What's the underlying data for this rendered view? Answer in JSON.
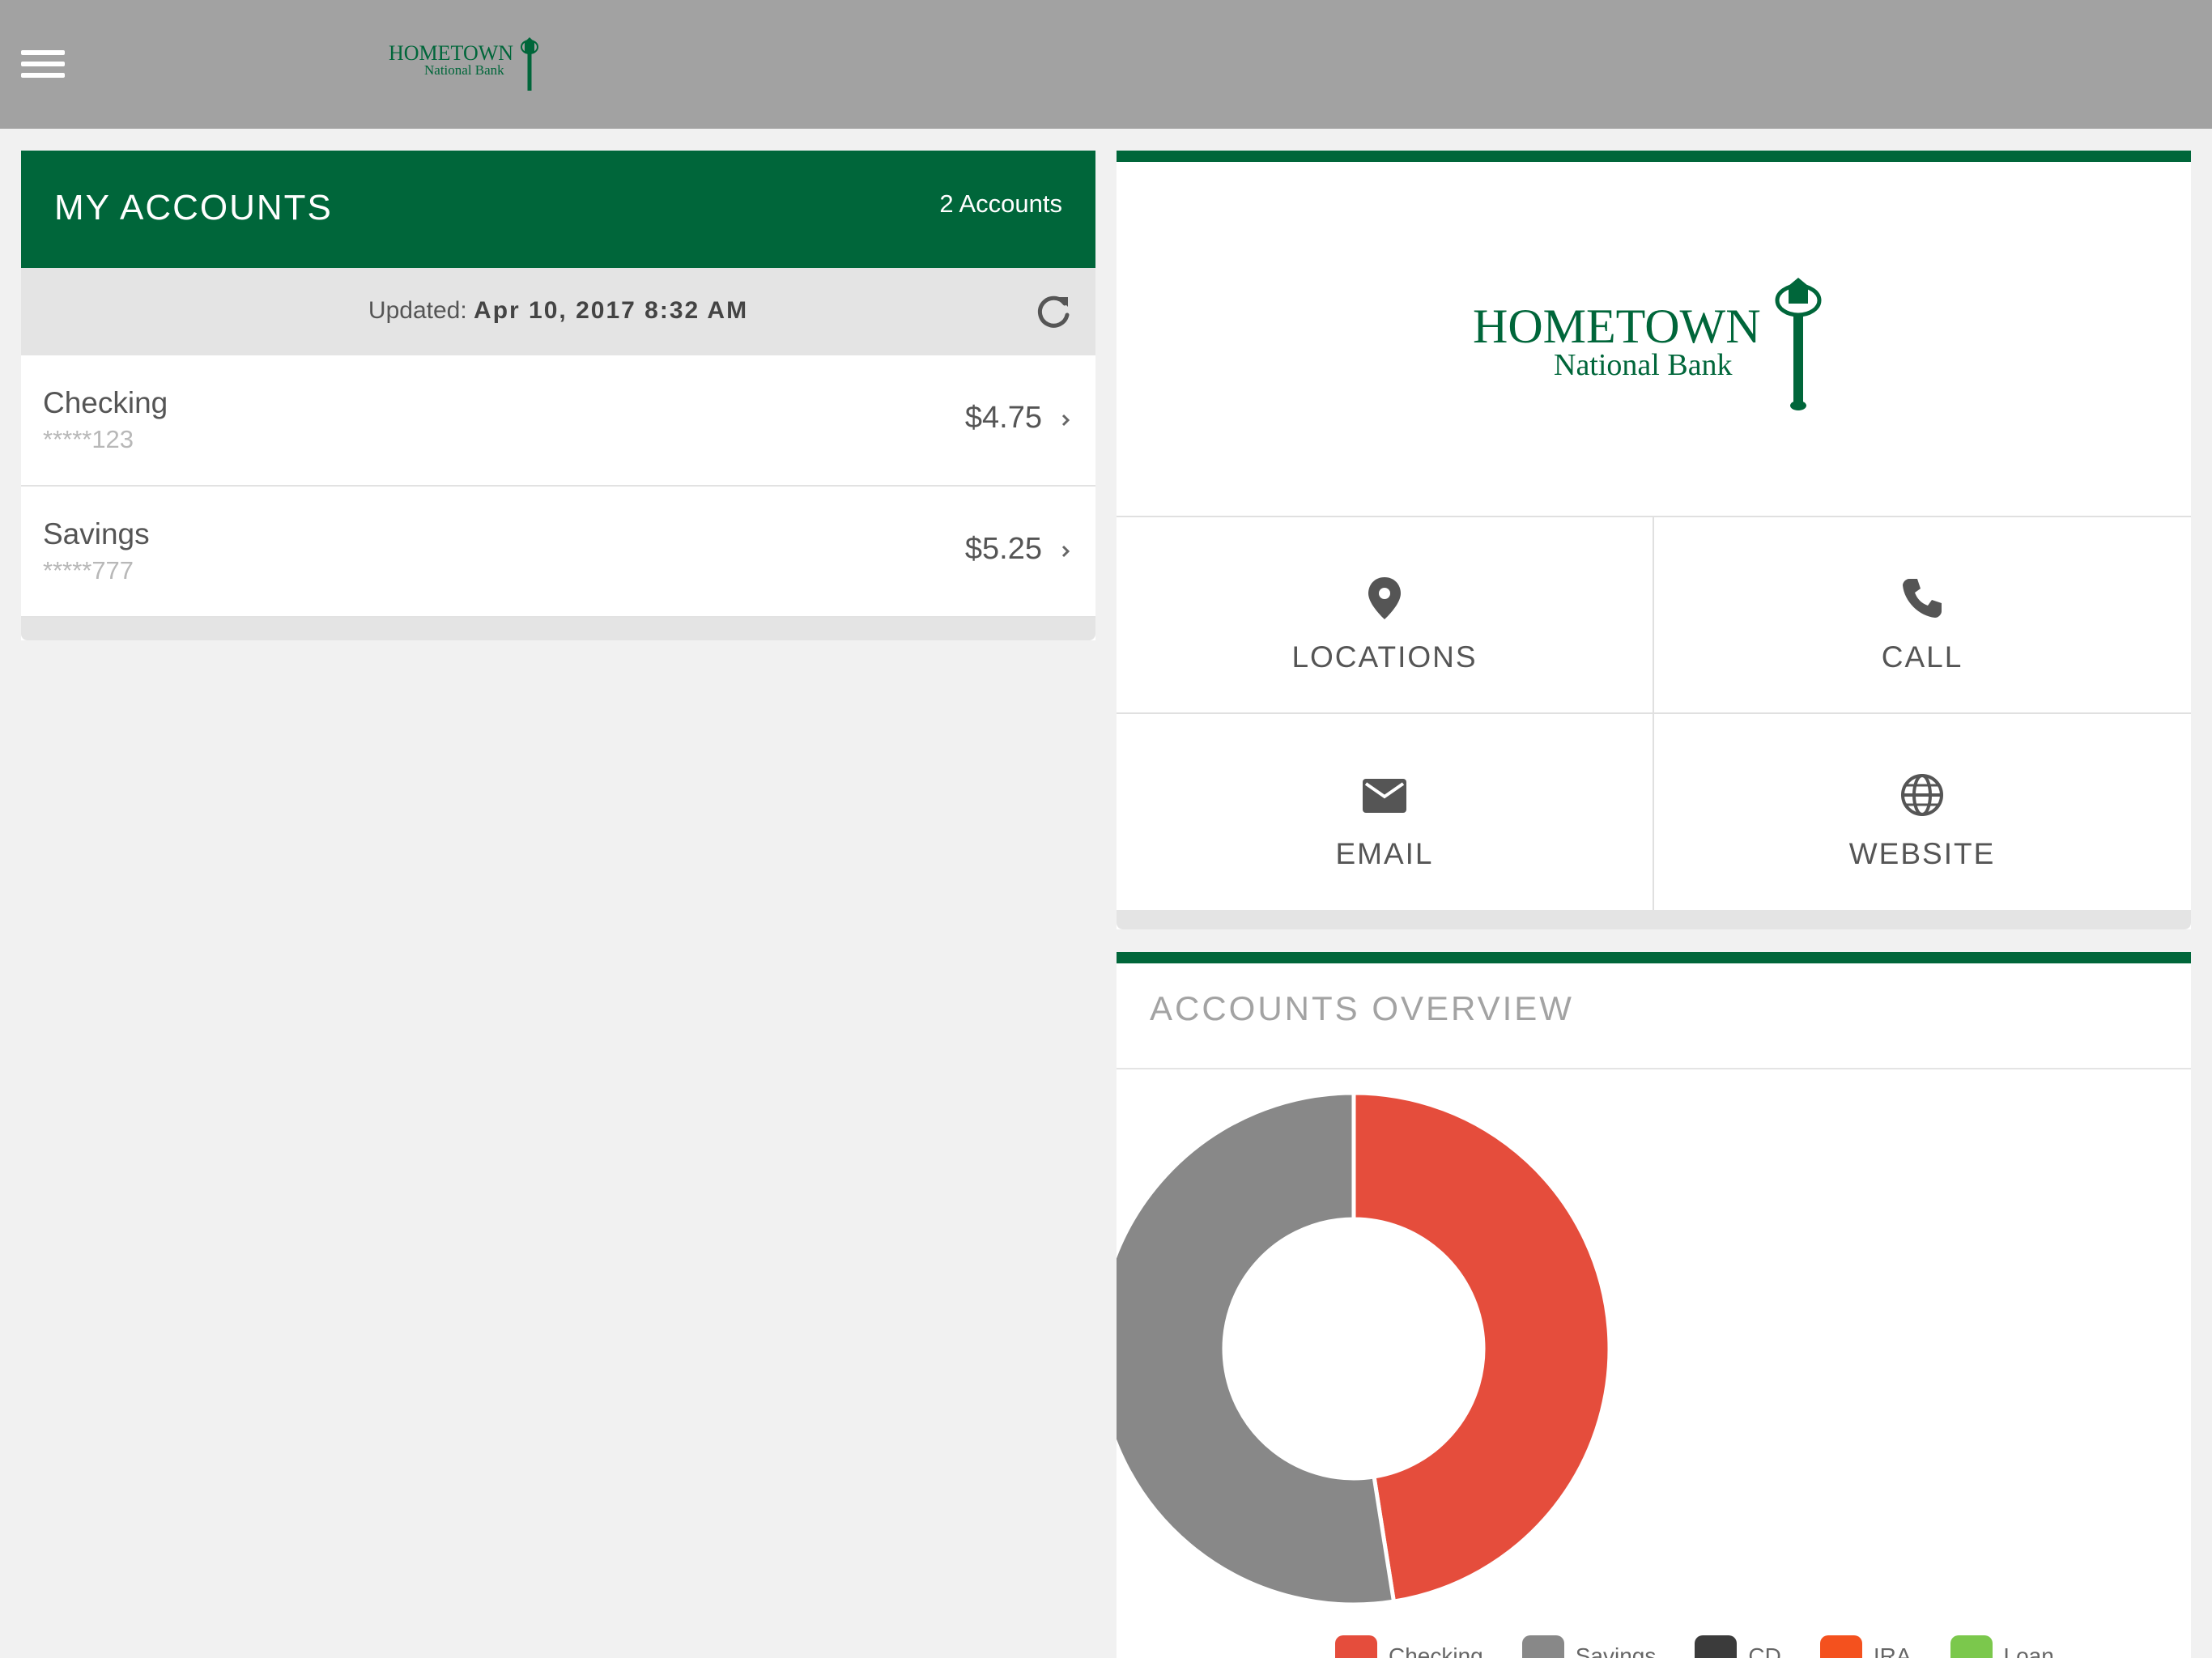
{
  "app": {
    "logo_line1": "HOMETOWN",
    "logo_line2": "National Bank"
  },
  "accounts": {
    "title": "MY ACCOUNTS",
    "count_label": "2 Accounts",
    "updated_prefix": "Updated:",
    "updated_value": "Apr 10, 2017 8:32 AM",
    "items": [
      {
        "name": "Checking",
        "number": "*****123",
        "balance": "$4.75"
      },
      {
        "name": "Savings",
        "number": "*****777",
        "balance": "$5.25"
      }
    ]
  },
  "bank": {
    "actions": [
      {
        "label": "LOCATIONS",
        "icon": "map-pin-icon"
      },
      {
        "label": "CALL",
        "icon": "phone-icon"
      },
      {
        "label": "EMAIL",
        "icon": "envelope-icon"
      },
      {
        "label": "WEBSITE",
        "icon": "globe-icon"
      }
    ]
  },
  "overview": {
    "title": "ACCOUNTS OVERVIEW",
    "legend": [
      "Checking",
      "Savings",
      "CD",
      "IRA",
      "Loan"
    ]
  },
  "chart_data": {
    "type": "pie",
    "categories": [
      "Checking",
      "Savings",
      "CD",
      "IRA",
      "Loan"
    ],
    "values": [
      4.75,
      5.25,
      0,
      0,
      0
    ],
    "colors": [
      "#e54d3c",
      "#888888",
      "#3b3b3b",
      "#f4511e",
      "#7bc84c"
    ],
    "legend_position": "bottom"
  },
  "colors": {
    "brand_green": "#00663a",
    "topbar": "#a2a2a2"
  }
}
